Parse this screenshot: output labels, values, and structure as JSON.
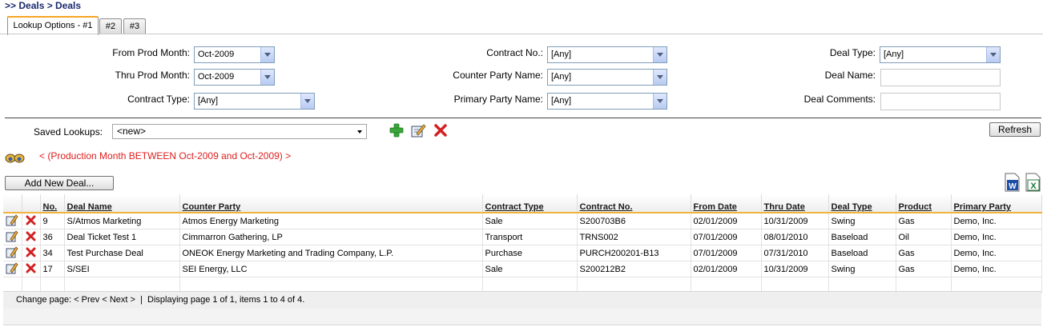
{
  "breadcrumb": ">> Deals > Deals",
  "tabs": [
    {
      "label": "Lookup Options - #1",
      "active": true
    },
    {
      "label": "#2",
      "active": false
    },
    {
      "label": "#3",
      "active": false
    }
  ],
  "filters": {
    "from_prod_month": {
      "label": "From Prod Month:",
      "value": "Oct-2009"
    },
    "thru_prod_month": {
      "label": "Thru Prod Month:",
      "value": "Oct-2009"
    },
    "contract_type": {
      "label": "Contract Type:",
      "value": "[Any]"
    },
    "contract_no": {
      "label": "Contract No.:",
      "value": "[Any]"
    },
    "counter_party_name": {
      "label": "Counter Party Name:",
      "value": "[Any]"
    },
    "primary_party_name": {
      "label": "Primary Party Name:",
      "value": "[Any]"
    },
    "deal_type": {
      "label": "Deal Type:",
      "value": "[Any]"
    },
    "deal_name": {
      "label": "Deal Name:",
      "value": ""
    },
    "deal_comments": {
      "label": "Deal Comments:",
      "value": ""
    }
  },
  "saved_lookups": {
    "label": "Saved Lookups:",
    "value": "<new>"
  },
  "refresh_label": "Refresh",
  "filter_summary": "< (Production Month BETWEEN Oct-2009 and Oct-2009) >",
  "add_deal_label": "Add New Deal...",
  "table": {
    "columns": [
      "No.",
      "Deal Name",
      "Counter Party",
      "Contract Type",
      "Contract No.",
      "From Date",
      "Thru Date",
      "Deal Type",
      "Product",
      "Primary Party"
    ],
    "rows": [
      [
        "9",
        "S/Atmos Marketing",
        "Atmos Energy Marketing",
        "Sale",
        "S200703B6",
        "02/01/2009",
        "10/31/2009",
        "Swing",
        "Gas",
        "Demo, Inc."
      ],
      [
        "36",
        "Deal Ticket Test 1",
        "Cimmarron Gathering, LP",
        "Transport",
        "TRNS002",
        "07/01/2009",
        "08/01/2010",
        "Baseload",
        "Oil",
        "Demo, Inc."
      ],
      [
        "34",
        "Test Purchase Deal",
        "ONEOK Energy Marketing and Trading Company, L.P.",
        "Purchase",
        "PURCH200201-B13",
        "07/01/2009",
        "07/31/2010",
        "Baseload",
        "Gas",
        "Demo, Inc."
      ],
      [
        "17",
        "S/SEI",
        "SEI Energy, LLC",
        "Sale",
        "S200212B2",
        "02/01/2009",
        "10/31/2009",
        "Swing",
        "Gas",
        "Demo, Inc."
      ]
    ]
  },
  "pager": {
    "change_page": "Change page:",
    "prev": "< Prev",
    "next": "< Next >",
    "status": "Displaying page 1 of 1, items 1 to 4 of 4."
  },
  "colors": {
    "accent": "#f2b33d",
    "filter_text": "#e02020",
    "breadcrumb": "#1a2a6c"
  },
  "icons": [
    "edit-icon",
    "delete-icon",
    "add-icon",
    "binoculars-icon",
    "word-export-icon",
    "excel-export-icon"
  ]
}
